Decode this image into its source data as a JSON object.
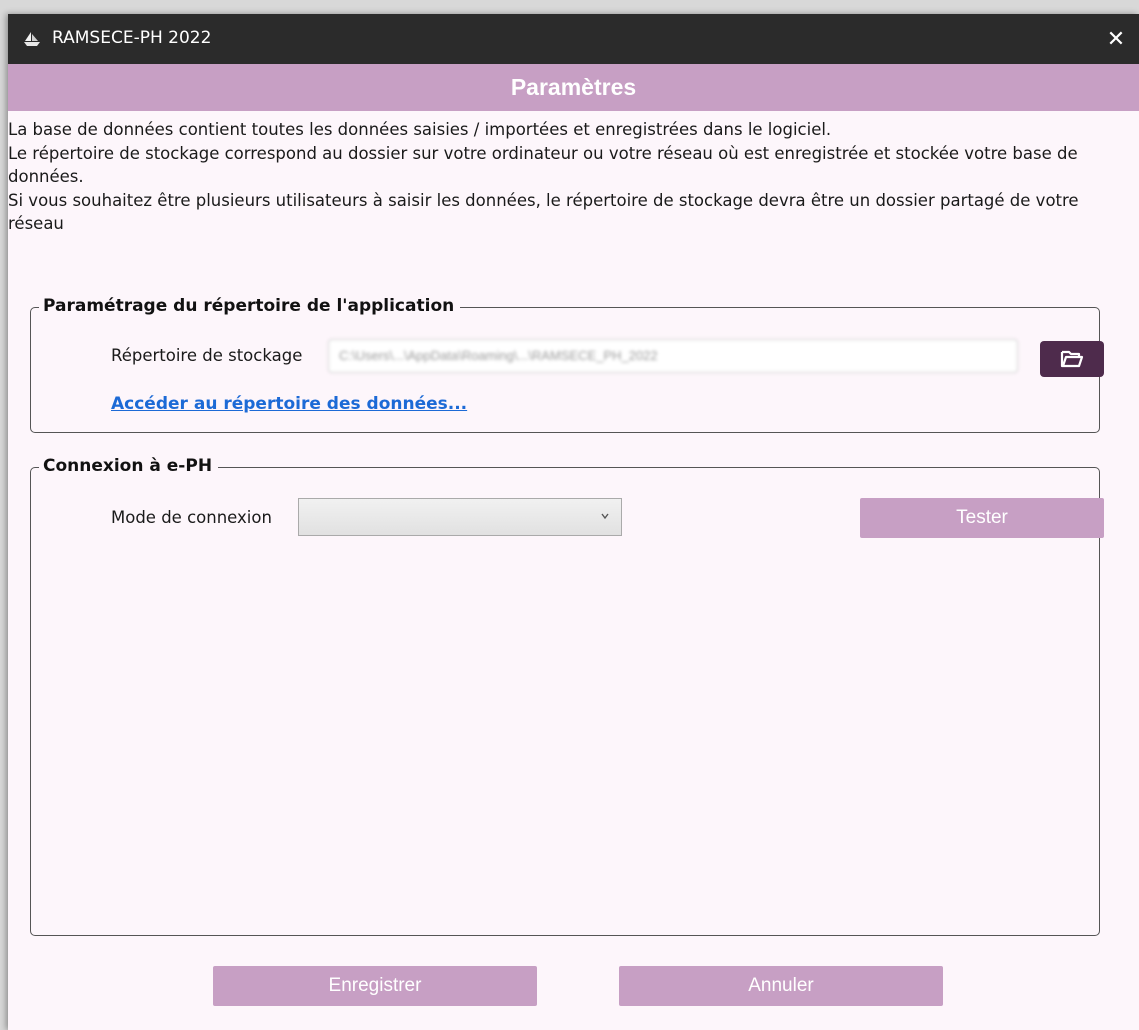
{
  "window": {
    "title": "RAMSECE-PH 2022",
    "close_glyph": "✕",
    "app_icon": "ship-icon"
  },
  "header": {
    "title": "Paramètres"
  },
  "intro": {
    "lines": [
      "La base de données contient toutes les données saisies / importées et enregistrées dans le logiciel.",
      "Le répertoire de stockage correspond au dossier sur votre ordinateur ou votre réseau où est enregistrée et stockée votre base de données.",
      "Si vous souhaitez être plusieurs utilisateurs à saisir les données, le répertoire de stockage devra être un dossier partagé de votre réseau"
    ]
  },
  "app_dir": {
    "legend": "Paramétrage du répertoire de l'application",
    "storage_label": "Répertoire de stockage",
    "storage_value": "C:\\Users\\...\\AppData\\Roaming\\...\\RAMSECE_PH_2022",
    "browse_icon": "folder-open-icon",
    "open_link": "Accéder au répertoire des données..."
  },
  "eph": {
    "legend": "Connexion à e-PH",
    "mode_label": "Mode de connexion",
    "mode_value": "",
    "test_button": "Tester"
  },
  "footer": {
    "save_button": "Enregistrer",
    "cancel_button": "Annuler"
  },
  "colors": {
    "accent": "#c79fc4",
    "accent_dark": "#4e2b4c",
    "titlebar": "#2b2b2b",
    "background": "#fdf6fb",
    "link": "#1c6ad6"
  }
}
